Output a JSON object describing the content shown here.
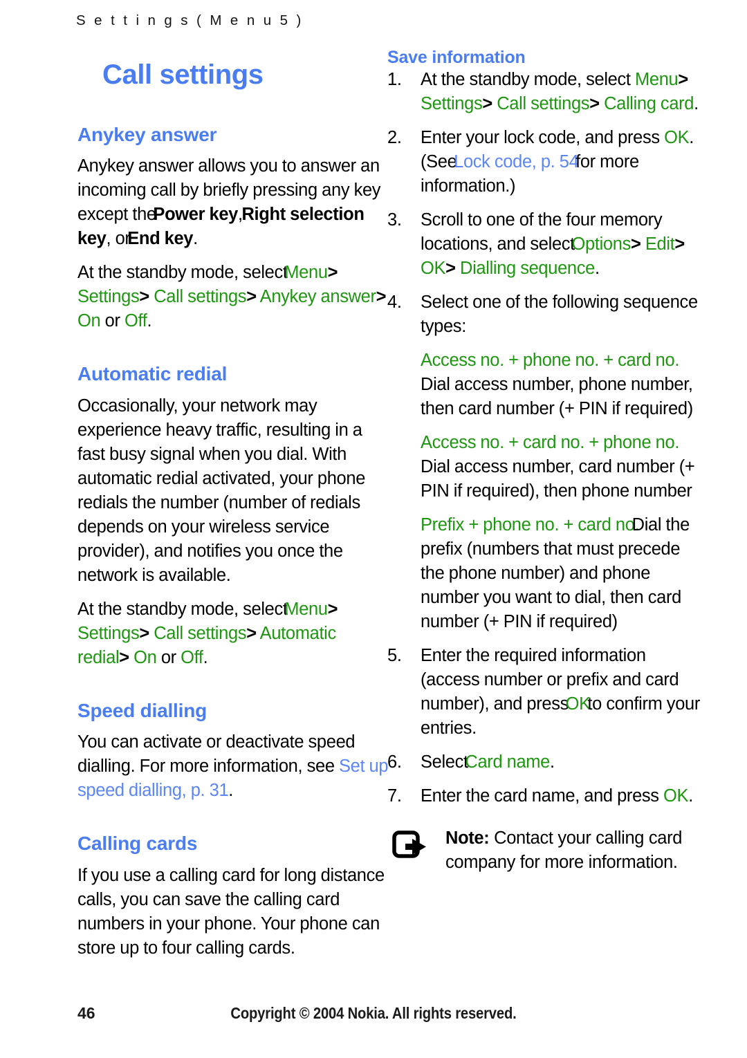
{
  "header": {
    "running_head": "S e t t i n g s   ( M e n u   5 )"
  },
  "colors": {
    "heading_blue": "#4a7df2",
    "xref_blue": "#5b86f5",
    "ui_green": "#1f9611",
    "body_black": "#000000"
  },
  "left_column": {
    "chapter_title": "Call settings",
    "sections": [
      {
        "heading": "Anykey answer",
        "paragraph_1": {
          "run_1": "Anykey answer allows you to answer an incoming call by briefly pressing any key except the ",
          "run_2_bold": "Power key",
          "run_3": ", ",
          "run_4_bold": "Right selection key",
          "run_5": ", or ",
          "run_6_bold": "End key",
          "run_7": "."
        },
        "paragraph_2": {
          "lead": "At the standby mode, select ",
          "path": [
            "Menu",
            "Settings",
            "Call settings",
            "Anykey answer"
          ],
          "sep": ">",
          "option_a": "On",
          "conjunction": " or ",
          "option_b": "Off",
          "end": "."
        }
      },
      {
        "heading": "Automatic redial",
        "paragraph_1": "Occasionally, your network may experience heavy traffic, resulting in a fast busy signal when you dial. With automatic redial activated, your phone redials the number (number of redials depends on your wireless service provider), and notifies you once the network is available.",
        "paragraph_2": {
          "lead": "At the standby mode, select ",
          "path": [
            "Menu",
            "Settings",
            "Call settings",
            "Automatic redial"
          ],
          "sep": ">",
          "option_a": "On",
          "conjunction": " or ",
          "option_b": "Off",
          "end": "."
        }
      },
      {
        "heading": "Speed dialling",
        "paragraph_1": {
          "run_1": "You can activate or deactivate speed dialling. For more information, see ",
          "xref": "Set up speed dialling",
          "xref_page": ", p. 31",
          "end": "."
        }
      },
      {
        "heading": "Calling cards",
        "paragraph_1": "If you use a calling card for long distance calls, you can save the calling card numbers in your phone. Your phone can store up to four calling cards."
      }
    ]
  },
  "right_column": {
    "subheading": "Save information",
    "steps": [
      {
        "num": "1.",
        "lead": "At the standby mode, select ",
        "path": [
          "Menu",
          "Settings",
          "Call settings",
          "Calling card"
        ],
        "sep": ">",
        "end": "."
      },
      {
        "num": "2.",
        "lead": "Enter your lock code, and press ",
        "key": "OK",
        "mid": ". (See ",
        "xref": "Lock code, p. 54",
        "tail": " for more information.)"
      },
      {
        "num": "3.",
        "lead": "Scroll to one of the four memory locations, and select ",
        "path": [
          "Options",
          "Edit",
          "OK",
          "Dialling sequence"
        ],
        "sep": ">",
        "end": "."
      },
      {
        "num": "4.",
        "lead": "Select one of the following sequence types:"
      },
      {
        "num": "5.",
        "lead": "Enter the required information (access number or prefix and card number), and press ",
        "key": "OK",
        "tail": " to confirm your entries."
      },
      {
        "num": "6.",
        "lead": "Select ",
        "key": "Card name",
        "tail": "."
      },
      {
        "num": "7.",
        "lead": "Enter the card name, and press ",
        "key": "OK",
        "tail": "."
      }
    ],
    "sequence_types": [
      {
        "label": "Access no. + phone no. + card no.",
        "description": "Dial access number, phone number, then card number (+ PIN if required)"
      },
      {
        "label": "Access no. + card no. + phone no.",
        "description": "Dial access number, card number (+ PIN if required), then phone number"
      },
      {
        "label": "Prefix + phone no. + card no.",
        "description": "Dial the prefix (numbers that must precede the phone number) and phone number you want to dial, then card number (+ PIN if required)"
      }
    ],
    "note": {
      "icon": "note-arrow-icon",
      "label": "Note:",
      "text": " Contact your calling card company for more information."
    }
  },
  "footer": {
    "page_number": "46",
    "copyright": "Copyright © 2004 Nokia. All rights reserved."
  }
}
